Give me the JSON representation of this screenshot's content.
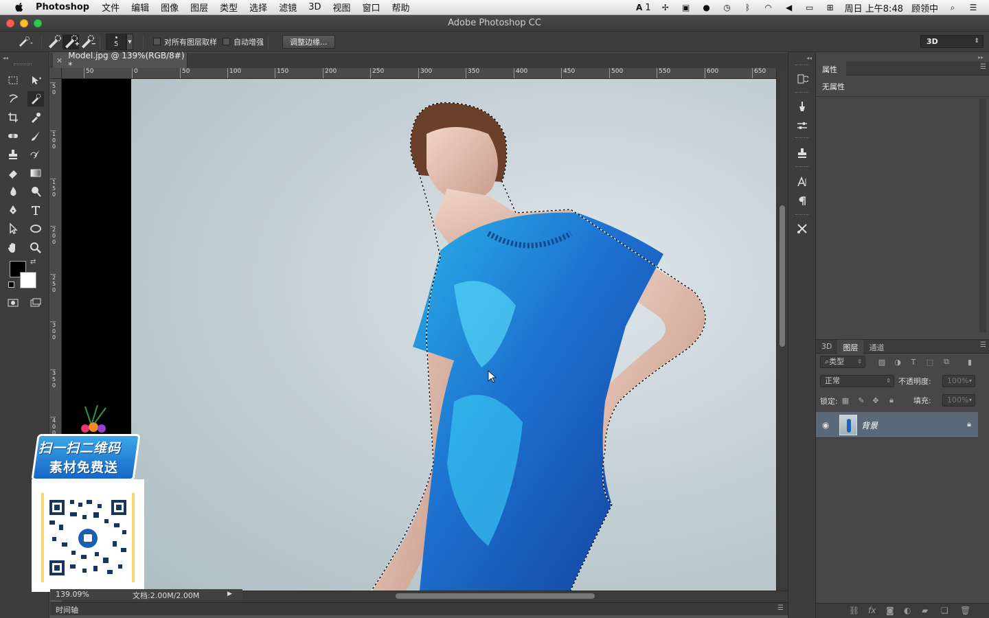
{
  "menubar": {
    "app_name": "Photoshop",
    "menus": [
      "文件",
      "编辑",
      "图像",
      "图层",
      "类型",
      "选择",
      "滤镜",
      "3D",
      "视图",
      "窗口",
      "帮助"
    ],
    "status_ai": "1",
    "clock": "周日 上午8:48",
    "user": "顾领中"
  },
  "window": {
    "title": "Adobe Photoshop CC"
  },
  "options": {
    "brush_size": "5",
    "sample_all_layers": "对所有图层取样",
    "auto_enhance": "自动增强",
    "refine_edge": "调整边缘...",
    "workspace": "3D"
  },
  "document": {
    "tab_title": "Model.jpg @ 139%(RGB/8#) *",
    "zoom": "139.09%",
    "doc_size": "文档:2.00M/2.00M"
  },
  "rulers": {
    "h_ticks": [
      "50",
      "0",
      "50",
      "100",
      "150",
      "200",
      "250",
      "300",
      "350",
      "400",
      "450",
      "500",
      "550",
      "600",
      "650"
    ],
    "v_ticks": [
      "50",
      "100",
      "150",
      "200",
      "250",
      "300",
      "350",
      "400"
    ]
  },
  "timeline": {
    "label": "时间轴"
  },
  "properties": {
    "tab": "属性",
    "empty_text": "无属性"
  },
  "layers_panel": {
    "tabs": [
      "3D",
      "图层",
      "通道"
    ],
    "active_tab": "图层",
    "filter_kind": "类型",
    "blend_mode": "正常",
    "opacity_label": "不透明度:",
    "opacity_value": "100%",
    "lock_label": "锁定:",
    "fill_label": "填充:",
    "fill_value": "100%",
    "layers": [
      {
        "name": "背景",
        "visible": true,
        "locked": true
      }
    ]
  },
  "promo": {
    "line1": "扫一扫二维码",
    "line2": "素材免费送"
  },
  "colors": {
    "foreground": "#000000",
    "background": "#ffffff",
    "dress_blue": "#1f63b8",
    "accent_blue": "#2a86d8"
  }
}
